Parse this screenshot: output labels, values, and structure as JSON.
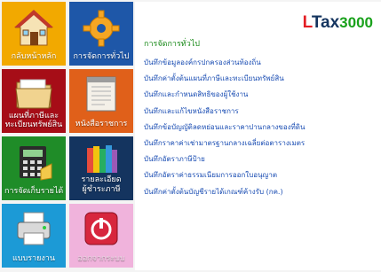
{
  "tiles": [
    {
      "label": "กลับหน้าหลัก"
    },
    {
      "label": "การจัดการทั่วไป"
    },
    {
      "label": "แผนที่ภาษีและ",
      "label2": "ทะเบียนทรัพย์สิน"
    },
    {
      "label": "หนังสือราชการ"
    },
    {
      "label": "การจัดเก็บรายได้"
    },
    {
      "label": "รายละเอียด",
      "label2": "ผู้ชำระภาษี"
    },
    {
      "label": "แบบรายงาน"
    },
    {
      "label": "ออกจากระบบ"
    }
  ],
  "logo": {
    "part1": "L",
    "part2": "Tax",
    "part3": "3000"
  },
  "panel": {
    "title": "การจัดการทั่วไป",
    "items": [
      "บันทึกข้อมูลองค์กรปกครองส่วนท้องถิ่น",
      "บันทึกค่าตั้งต้นแผนที่ภาษีและทะเบียนทรัพย์สิน",
      "บันทึกและกำหนดสิทธิของผู้ใช้งาน",
      "บันทึกและแก้ไขหนังสือราชการ",
      "บันทึกข้อบัญญัติลดหย่อนและราคาปานกลางของที่ดิน",
      "บันทึกราคาค่าเช่ามาตรฐานกลางเฉลี่ยต่อตารางเมตร",
      "บันทึกอัตราภาษีป้าย",
      "บันทึกอัตราค่าธรรมเนียมการออกใบอนุญาต",
      "บันทึกค่าตั้งต้นบัญชีรายได้เกณฑ์ค้างรับ (กค.)"
    ]
  }
}
